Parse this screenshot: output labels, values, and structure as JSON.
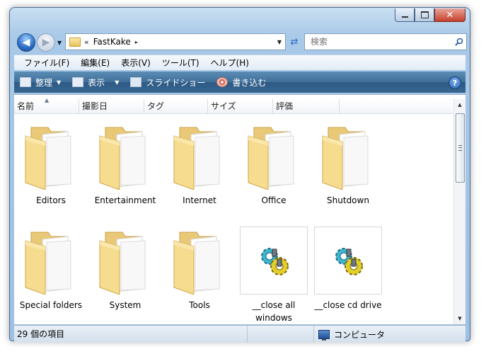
{
  "window": {
    "caption_buttons": {
      "minimize": "minimize",
      "maximize": "maximize",
      "close": "close"
    }
  },
  "address": {
    "chevrons": "«",
    "path": "FastKake",
    "arrow": "▸"
  },
  "search": {
    "placeholder": "検索"
  },
  "menubar": {
    "items": [
      "ファイル(F)",
      "編集(E)",
      "表示(V)",
      "ツール(T)",
      "ヘルプ(H)"
    ]
  },
  "commandbar": {
    "organize": "整理",
    "view": "表示",
    "slideshow": "スライドショー",
    "burn": "書き込む",
    "help_glyph": "?"
  },
  "columns": [
    "名前",
    "撮影日",
    "タグ",
    "サイズ",
    "評価"
  ],
  "items": [
    {
      "label": "Editors",
      "type": "folder"
    },
    {
      "label": "Entertainment",
      "type": "folder"
    },
    {
      "label": "Internet",
      "type": "folder"
    },
    {
      "label": "Office",
      "type": "folder"
    },
    {
      "label": "Shutdown",
      "type": "folder"
    },
    {
      "label": "Special folders",
      "type": "folder"
    },
    {
      "label": "System",
      "type": "folder"
    },
    {
      "label": "Tools",
      "type": "folder"
    },
    {
      "label": "__close all windows",
      "type": "shortcut"
    },
    {
      "label": "__close cd drive",
      "type": "shortcut"
    }
  ],
  "status": {
    "count": "29 個の項目",
    "location": "コンピュータ"
  },
  "colors": {
    "command_bar": "#3f6f99",
    "folder": "#f6dc8e",
    "accent": "#2b6bc4"
  }
}
